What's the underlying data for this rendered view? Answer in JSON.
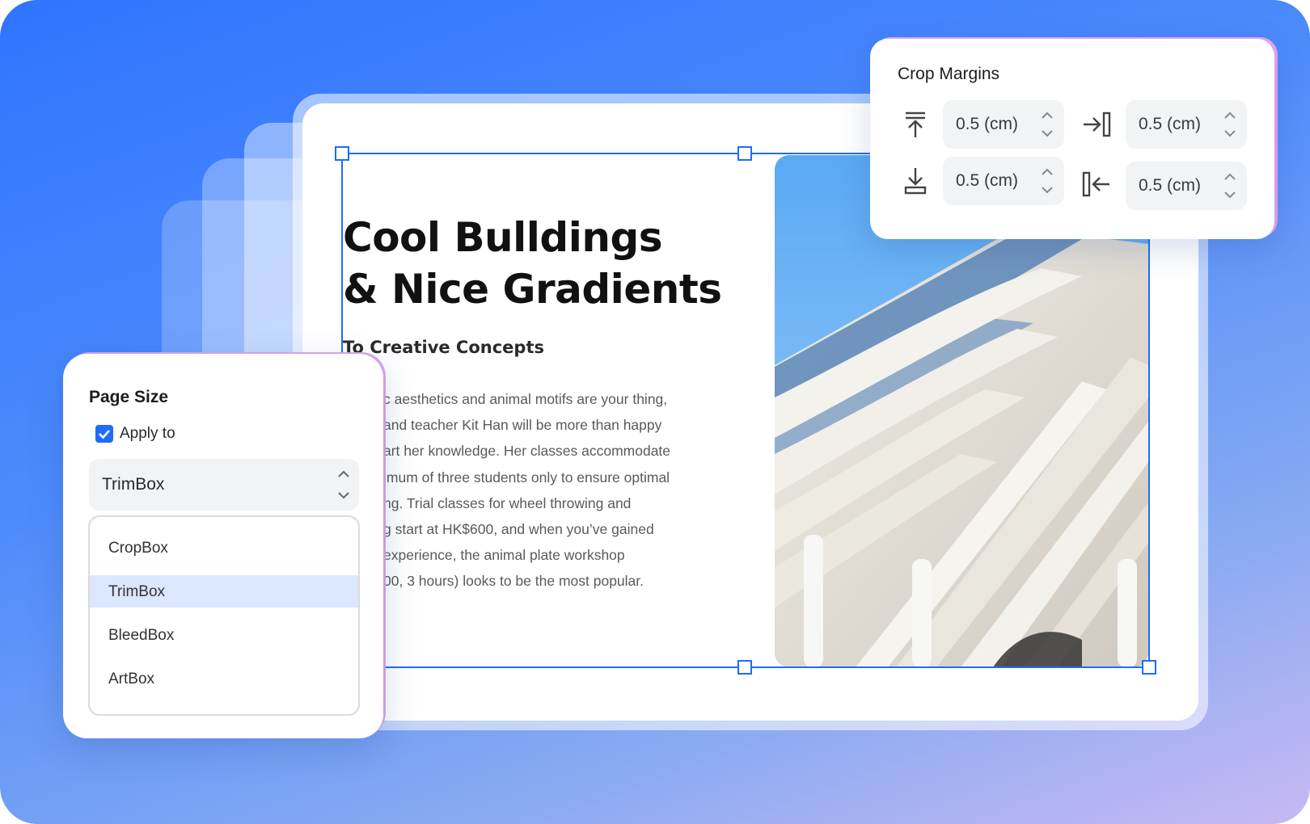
{
  "document": {
    "title_line1": "Cool Bulldings",
    "title_line2": "& Nice Gradients",
    "subtitle": "To Creative Concepts",
    "body_lines": [
      "c aesthetics and animal motifs are your thing,",
      "and teacher Kit Han will be more than happy",
      "art her knowledge. Her classes accommodate",
      "imum of three students only to ensure optimal",
      "ng. Trial classes for wheel throwing and",
      "g start at HK$600, and when you’ve gained",
      "experience, the animal plate workshop",
      "00, 3 hours) looks to be the most popular."
    ]
  },
  "crop_margins": {
    "title": "Crop Margins",
    "fields": [
      {
        "icon": "align-top-icon",
        "value": "0.5 (cm)"
      },
      {
        "icon": "align-right-icon",
        "value": "0.5 (cm)"
      },
      {
        "icon": "align-bottom-icon",
        "value": "0.5 (cm)"
      },
      {
        "icon": "align-left-icon",
        "value": "0.5 (cm)"
      }
    ]
  },
  "page_size": {
    "title": "Page Size",
    "apply_to_label": "Apply to",
    "apply_to_checked": true,
    "selected": "TrimBox",
    "options": [
      "CropBox",
      "TrimBox",
      "BleedBox",
      "ArtBox"
    ],
    "highlighted_option": "TrimBox"
  },
  "colors": {
    "accent": "#1f6bff",
    "selection_highlight": "#dbe6ff",
    "background_top": "#2f74ff",
    "background_bottom": "#c7b9f3"
  }
}
